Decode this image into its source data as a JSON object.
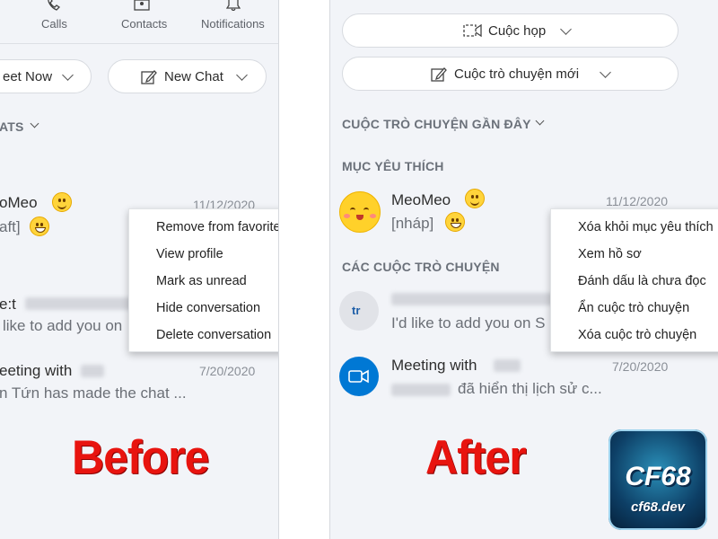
{
  "before": {
    "nav": {
      "calls": "Calls",
      "contacts": "Contacts",
      "notifications": "Notifications"
    },
    "meet_now": "eet Now",
    "new_chat": "New Chat",
    "chats_header": "ATS",
    "meomeo": {
      "name": "oMeo",
      "date": "11/12/2020",
      "draft": "aft]"
    },
    "chat2": {
      "name": "e:t",
      "preview": "like to add you on"
    },
    "meeting": {
      "name": "eeting with",
      "date": "7/20/2020",
      "preview": "n Tứn has made the chat ..."
    },
    "menu": [
      "Remove from favorites",
      "View profile",
      "Mark as unread",
      "Hide conversation",
      "Delete conversation"
    ],
    "caption": "Before"
  },
  "after": {
    "meeting_btn": "Cuộc họp",
    "new_chat_btn": "Cuộc trò chuyện mới",
    "recent_header": "CUỘC TRÒ CHUYỆN GẦN ĐÂY",
    "favorites_header": "MỤC YÊU THÍCH",
    "meomeo": {
      "name": "MeoMeo",
      "date": "11/12/2020",
      "draft": "[nháp]"
    },
    "chats_header": "CÁC CUỘC TRÒ CHUYỆN",
    "chat2": {
      "avatar": "tr",
      "preview": "I'd like to add you on S"
    },
    "meeting": {
      "name": "Meeting with",
      "date": "7/20/2020",
      "preview": "đã hiển thị lịch sử c..."
    },
    "menu": [
      "Xóa khỏi mục yêu thích",
      "Xem hồ sơ",
      "Đánh dấu là chưa đọc",
      "Ẩn cuộc trò chuyện",
      "Xóa cuộc trò chuyện"
    ],
    "caption": "After"
  },
  "logo": {
    "brand": "CF68",
    "domain": "cf68.dev"
  },
  "colors": {
    "panel_bg": "#f2f4f8",
    "caption_red": "#e8140f",
    "skype_blue": "#0078d4"
  }
}
